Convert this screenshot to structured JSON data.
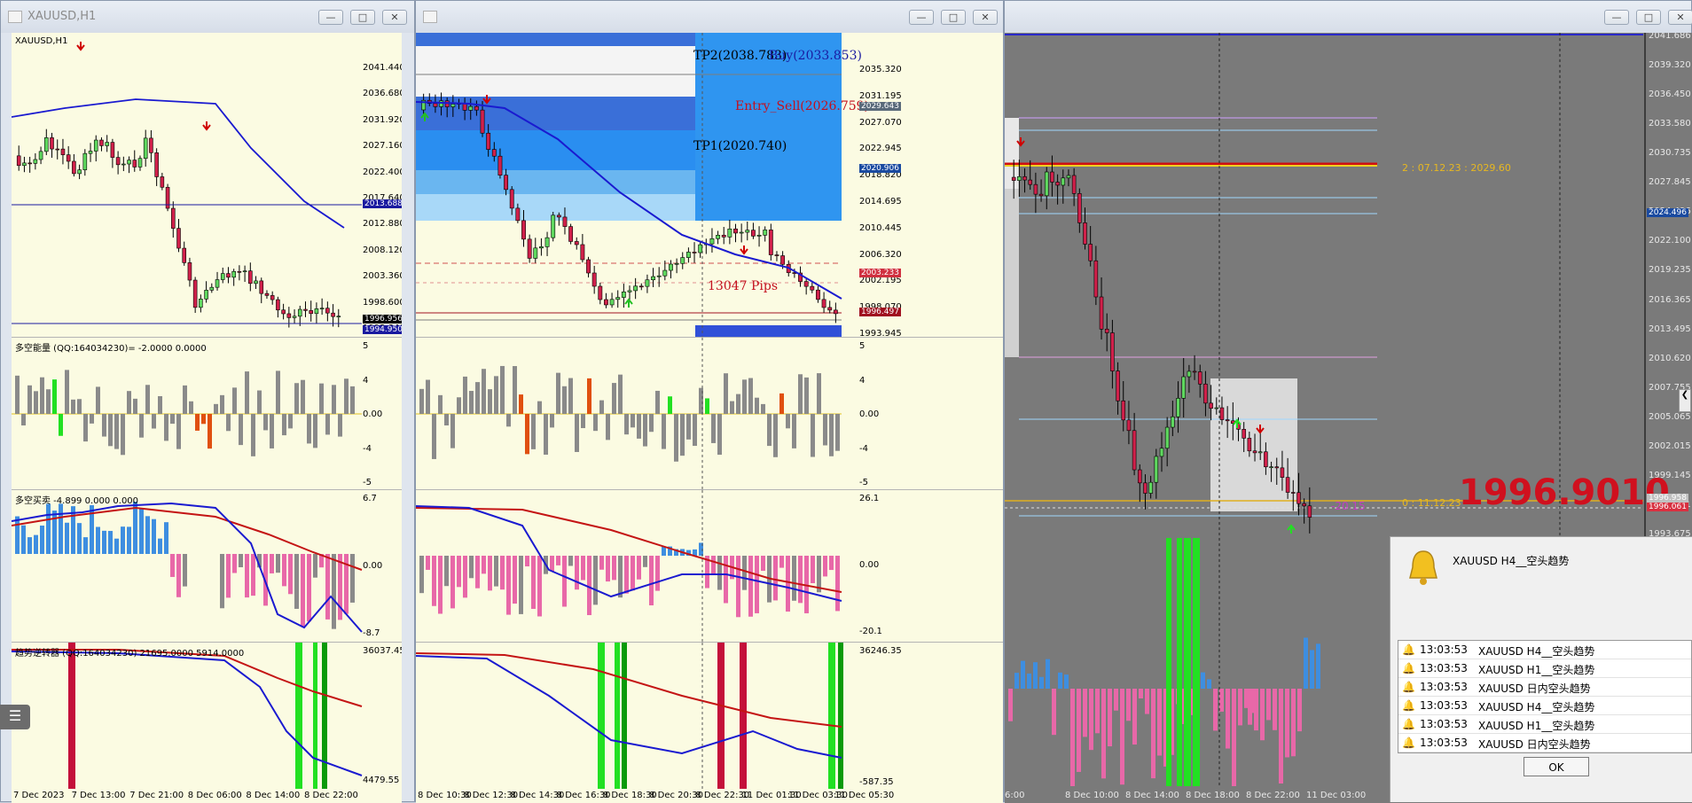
{
  "window1": {
    "title": "XAUUSD,H1",
    "symbol_label": "XAUUSD,H1",
    "price_axis": [
      "2041.440",
      "2036.680",
      "2031.920",
      "2027.160",
      "2022.400",
      "2017.640",
      "2012.880",
      "2008.120",
      "2003.360",
      "1998.600",
      "1993.840"
    ],
    "price_tags": {
      "current": "1996.956",
      "low": "1994.950",
      "line": "2013.688"
    },
    "ind1_label": "多空能量 (QQ:164034230)=  -2.0000 0.0000",
    "ind1_axis": [
      "5",
      "4",
      "0.00",
      "-4",
      "-5"
    ],
    "ind2_label": "多空买卖 -4.899 0.000 0.000",
    "ind2_axis": [
      "6.7",
      "0.00",
      "-8.7"
    ],
    "ind3_label": "趋势逆转器 (QQ:164034230)   21695.0000 5914.0000",
    "ind3_axis": [
      "36037.45",
      "4479.55"
    ],
    "time_axis": [
      "7 Dec 2023",
      "7 Dec 13:00",
      "7 Dec 21:00",
      "8 Dec 06:00",
      "8 Dec 14:00",
      "8 Dec 22:00"
    ]
  },
  "window2": {
    "price_axis": [
      "2035.320",
      "2031.195",
      "2027.070",
      "2022.945",
      "2018.820",
      "2014.695",
      "2010.445",
      "2006.320",
      "2002.195",
      "1998.070",
      "1993.945"
    ],
    "price_tags": {
      "tp2": "2029.643",
      "tp1": "2020.906",
      "entry": "2003.233",
      "current": "1996.497"
    },
    "texts": {
      "tp2": "TP2(2038.783)",
      "buy": "Buy(2033.853)",
      "entry_sell": "Entry_Sell(2026.759)",
      "tp1": "TP1(2020.740)",
      "pips": "13047 Pips"
    },
    "ind1_axis": [
      "5",
      "4",
      "0.00",
      "-4",
      "-5"
    ],
    "ind2_axis": [
      "26.1",
      "0.00",
      "-20.1"
    ],
    "ind3_axis": [
      "36246.35",
      "-587.35"
    ],
    "time_axis": [
      "8 Dec 10:30",
      "8 Dec 12:30",
      "8 Dec 14:30",
      "8 Dec 16:30",
      "8 Dec 18:30",
      "8 Dec 20:30",
      "8 Dec 22:30",
      "11 Dec 01:30",
      "11 Dec 03:30",
      "11 Dec 05:30"
    ]
  },
  "window3": {
    "price_axis": [
      "2041.686",
      "2039.320",
      "2036.450",
      "2033.580",
      "2030.735",
      "2027.845",
      "2024.496",
      "2022.100",
      "2019.235",
      "2016.365",
      "2013.495",
      "2010.620",
      "2007.755",
      "2005.065",
      "2002.015",
      "1999.145",
      "1996.061",
      "1993.675"
    ],
    "big_price": "1996.9010",
    "level_top": "2 : 07.12.23 : 2029.60",
    "level_bottom": "0 : 11.12.23",
    "small_text": "-20.15",
    "time_axis": [
      "6:00",
      "8 Dec 10:00",
      "8 Dec 14:00",
      "8 Dec 18:00",
      "8 Dec 22:00",
      "11 Dec 03:00"
    ],
    "tags": {
      "line": "2024.496",
      "cur1": "1996.958",
      "cur2": "1996.061"
    }
  },
  "alert": {
    "message": "XAUUSD  H4__空头趋势",
    "rows": [
      {
        "time": "13:03:53",
        "text": "XAUUSD  H4__空头趋势"
      },
      {
        "time": "13:03:53",
        "text": "XAUUSD  H1__空头趋势"
      },
      {
        "time": "13:03:53",
        "text": "XAUUSD  日内空头趋势"
      },
      {
        "time": "13:03:53",
        "text": "XAUUSD  H4__空头趋势"
      },
      {
        "time": "13:03:53",
        "text": "XAUUSD  H1__空头趋势"
      },
      {
        "time": "13:03:53",
        "text": "XAUUSD  日内空头趋势"
      }
    ],
    "ok_label": "OK"
  },
  "colors": {
    "bull": "#2a9b2a",
    "bear": "#c4101e",
    "ma": "#1a1ad0",
    "red_line": "#c41414",
    "hist_gray": "#8a8a8a",
    "hist_blue": "#3e8ee0",
    "hist_pink": "#e868a8",
    "signal_green": "#22e022",
    "signal_red": "#c4103a"
  }
}
